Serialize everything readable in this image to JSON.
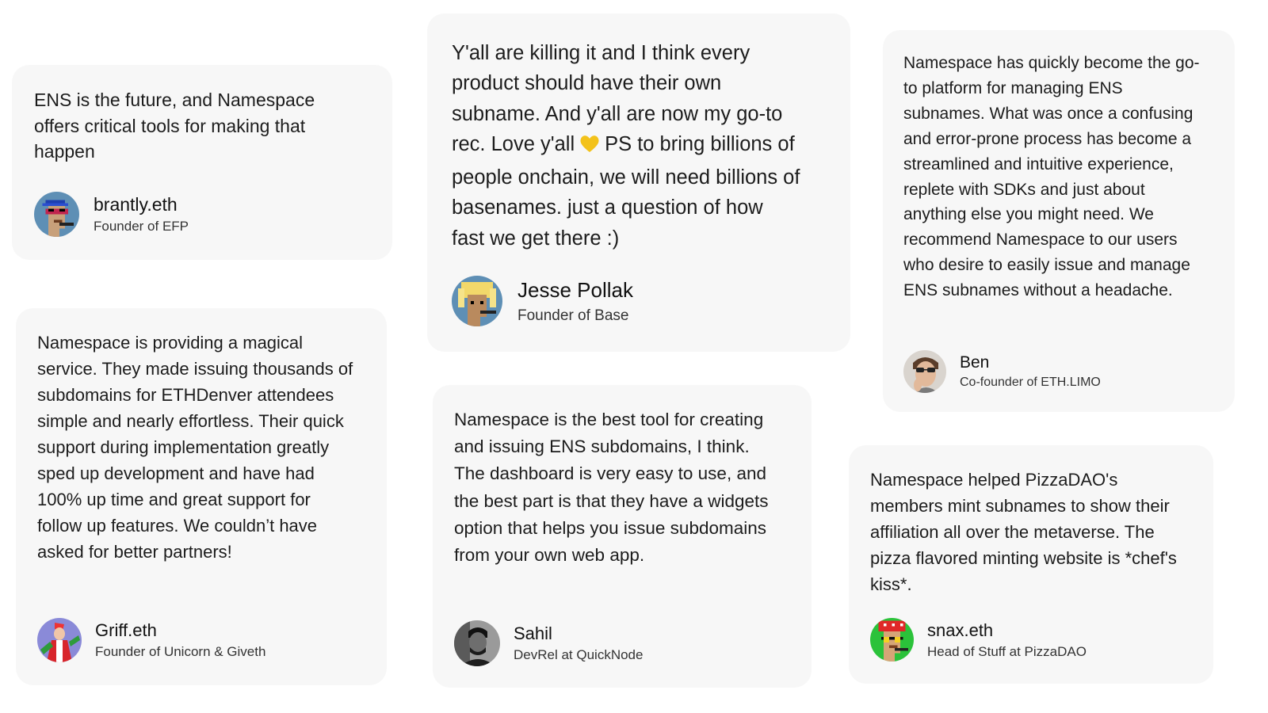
{
  "testimonials": [
    {
      "quote": "ENS is the future, and Namespace offers critical tools for making that happen",
      "name": "brantly.eth",
      "role": "Founder of EFP",
      "avatar": "punk-avatar-blue-cap"
    },
    {
      "quote_part1": "Y'all are killing it and I think every product should have their own subname. And y'all are now my go-to rec. Love y'all",
      "quote_emoji": "💛",
      "quote_part2": "PS to bring billions of people onchain, we will need billions of basenames. just a question of how fast we get there :)",
      "name": "Jesse Pollak",
      "role": "Founder of Base",
      "avatar": "punk-avatar-blonde"
    },
    {
      "quote": "Namespace has quickly become the go-to platform for managing ENS subnames. What was once a confusing and error-prone process has become a streamlined and intuitive experience, replete with SDKs and just about anything else you might need. We recommend Namespace to our users who desire to easily issue and manage ENS subnames without a headache.",
      "name": "Ben",
      "role": "Co-founder of ETH.LIMO",
      "avatar": "photo-avatar-sunglasses"
    },
    {
      "quote": "Namespace is providing a magical service. They made issuing thousands of subdomains for ETHDenver attendees simple and nearly effortless. Their quick support during implementation greatly sped up development and have had 100% up time and great support for follow up features. We couldn’t have asked for better partners!",
      "name": "Griff.eth",
      "role": "Founder of Unicorn & Giveth",
      "avatar": "illustrated-avatar-red-suit"
    },
    {
      "quote": "Namespace is the best tool for creating and issuing ENS subdomains, I think. The dashboard is very easy to use, and the best part is that they have a widgets option that helps you issue subdomains from your own web app.",
      "name": "Sahil",
      "role": "DevRel at QuickNode",
      "avatar": "photo-avatar-bw"
    },
    {
      "quote": "Namespace helped PizzaDAO's members mint subnames to show their affiliation all over the metaverse. The pizza flavored minting website is *chef's kiss*.",
      "name": "snax.eth",
      "role": "Head of Stuff at PizzaDAO",
      "avatar": "punk-avatar-pizza-hat"
    }
  ]
}
